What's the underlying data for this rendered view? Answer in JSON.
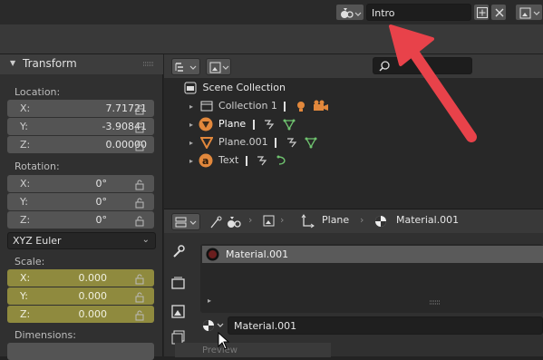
{
  "topbar": {
    "scene_name": "Intro",
    "icons": [
      "scene-icon",
      "add-icon",
      "close-icon",
      "image-icon"
    ]
  },
  "properties": {
    "title": "Transform",
    "location": {
      "label": "Location:",
      "x": "7.71721",
      "y": "-3.90841",
      "z": "0.00000"
    },
    "rotation": {
      "label": "Rotation:",
      "x": "0°",
      "y": "0°",
      "z": "0°"
    },
    "rotation_mode": "XYZ Euler",
    "scale": {
      "label": "Scale:",
      "x": "0.000",
      "y": "0.000",
      "z": "0.000"
    },
    "dimensions_label": "Dimensions:",
    "axis_x": "X:",
    "axis_y": "Y:",
    "axis_z": "Z:"
  },
  "outliner": {
    "root": "Scene Collection",
    "items": [
      {
        "label": "Collection 1"
      },
      {
        "label": "Plane"
      },
      {
        "label": "Plane.001"
      },
      {
        "label": "Text"
      }
    ]
  },
  "material_editor": {
    "breadcrumb_object": "Plane",
    "breadcrumb_material": "Material.001",
    "slot_name": "Material.001",
    "material_field": "Material.001",
    "truncated_text": "Preview"
  },
  "colors": {
    "accent_arrow": "#e8424a",
    "scale_field": "#8f8a3e",
    "object_orange": "#e2883c",
    "mesh_green": "#6fc36f"
  }
}
